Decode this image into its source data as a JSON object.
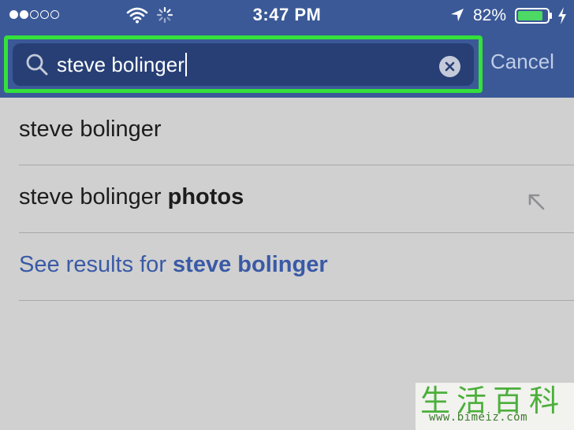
{
  "status_bar": {
    "time": "3:47 PM",
    "battery_percent": "82%",
    "signal_bars_filled": 2,
    "signal_bars_total": 5,
    "icons": [
      "signal-dots-icon",
      "wifi-icon",
      "activity-spinner-icon",
      "location-arrow-icon",
      "battery-icon",
      "charging-bolt-icon"
    ]
  },
  "search": {
    "query": "steve bolinger",
    "clear_icon": "clear-x-icon",
    "cancel_label": "Cancel"
  },
  "suggestions": [
    {
      "text": "steve bolinger",
      "bold_suffix": ""
    },
    {
      "text": "steve bolinger ",
      "bold_suffix": "photos",
      "action_icon": "fill-arrow-icon"
    }
  ],
  "see_results": {
    "prefix": "See results for ",
    "query": "steve bolinger"
  },
  "watermark": {
    "chars": "生活百科",
    "url": "www.bimeiz.com"
  },
  "colors": {
    "header_blue": "#3b5997",
    "search_field": "#273f75",
    "highlight_green": "#33e13a",
    "link_blue": "#3a5aa6",
    "background": "#d0d0d0"
  }
}
